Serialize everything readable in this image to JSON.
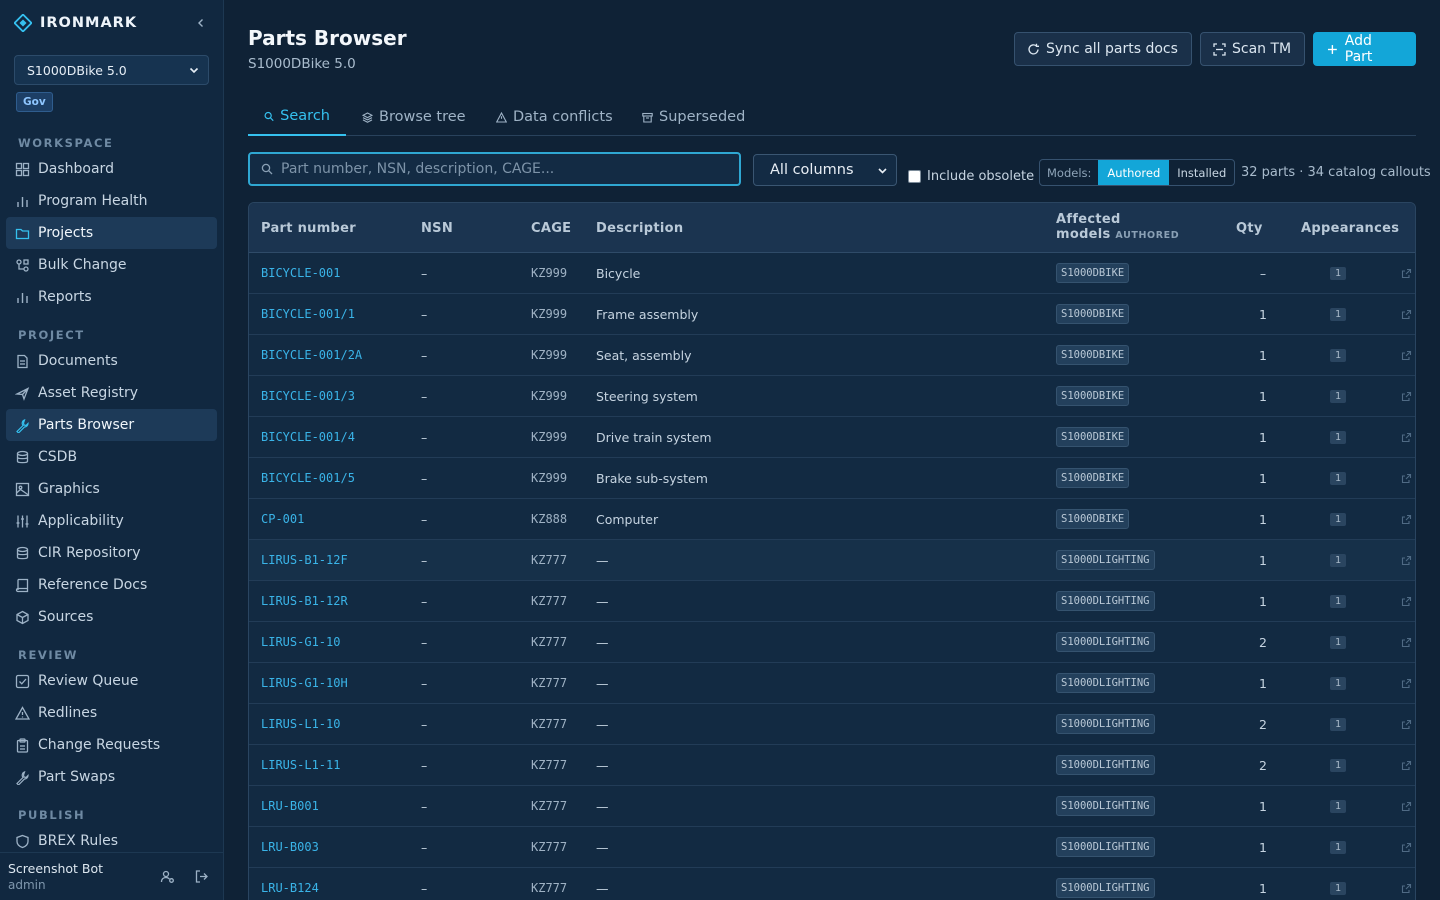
{
  "app": {
    "name": "IRONMARK"
  },
  "sidebar": {
    "project_select": "S1000DBike 5.0",
    "badge": "Gov",
    "sections": {
      "workspace": "WORKSPACE",
      "project": "PROJECT",
      "review": "REVIEW",
      "publish": "PUBLISH"
    },
    "items": [
      {
        "label": "Dashboard",
        "icon": "dashboard-icon"
      },
      {
        "label": "Program Health",
        "icon": "bar-chart-icon"
      },
      {
        "label": "Projects",
        "icon": "folder-icon"
      },
      {
        "label": "Bulk Change",
        "icon": "bulk-change-icon"
      },
      {
        "label": "Reports",
        "icon": "bar-chart-icon"
      },
      {
        "label": "Documents",
        "icon": "document-icon"
      },
      {
        "label": "Asset Registry",
        "icon": "airplane-icon"
      },
      {
        "label": "Parts Browser",
        "icon": "wrench-icon"
      },
      {
        "label": "CSDB",
        "icon": "database-icon"
      },
      {
        "label": "Graphics",
        "icon": "image-icon"
      },
      {
        "label": "Applicability",
        "icon": "sliders-icon"
      },
      {
        "label": "CIR Repository",
        "icon": "database-icon"
      },
      {
        "label": "Reference Docs",
        "icon": "book-icon"
      },
      {
        "label": "Sources",
        "icon": "package-icon"
      },
      {
        "label": "Review Queue",
        "icon": "check-square-icon"
      },
      {
        "label": "Redlines",
        "icon": "warning-icon"
      },
      {
        "label": "Change Requests",
        "icon": "clipboard-icon"
      },
      {
        "label": "Part Swaps",
        "icon": "wrench-icon"
      },
      {
        "label": "BREX Rules",
        "icon": "shield-icon"
      }
    ],
    "user": {
      "name": "Screenshot Bot",
      "role": "admin"
    }
  },
  "header": {
    "title": "Parts Browser",
    "subtitle": "S1000DBike 5.0",
    "sync_label": "Sync all parts docs",
    "scan_label": "Scan TM",
    "add_label": "Add Part"
  },
  "tabs": [
    "Search",
    "Browse tree",
    "Data conflicts",
    "Superseded"
  ],
  "toolbar": {
    "search_placeholder": "Part number, NSN, description, CAGE...",
    "column_select": "All columns",
    "include_obsolete": "Include obsolete",
    "models_label": "Models:",
    "models_authored": "Authored",
    "models_installed": "Installed",
    "count_text": "32 parts · 34 catalog callouts"
  },
  "table": {
    "headers": {
      "part_number": "Part number",
      "nsn": "NSN",
      "cage": "CAGE",
      "description": "Description",
      "affected_models": "Affected",
      "affected_models_2": "models",
      "affected_models_tag": "AUTHORED",
      "qty": "Qty",
      "appearances": "Appearances"
    },
    "rows": [
      {
        "part": "BICYCLE-001",
        "nsn": "–",
        "cage": "KZ999",
        "desc": "Bicycle",
        "model": "S1000DBIKE",
        "qty": "–",
        "app": "1"
      },
      {
        "part": "BICYCLE-001/1",
        "nsn": "–",
        "cage": "KZ999",
        "desc": "Frame assembly",
        "model": "S1000DBIKE",
        "qty": "1",
        "app": "1"
      },
      {
        "part": "BICYCLE-001/2A",
        "nsn": "–",
        "cage": "KZ999",
        "desc": "Seat, assembly",
        "model": "S1000DBIKE",
        "qty": "1",
        "app": "1"
      },
      {
        "part": "BICYCLE-001/3",
        "nsn": "–",
        "cage": "KZ999",
        "desc": "Steering system",
        "model": "S1000DBIKE",
        "qty": "1",
        "app": "1"
      },
      {
        "part": "BICYCLE-001/4",
        "nsn": "–",
        "cage": "KZ999",
        "desc": "Drive train system",
        "model": "S1000DBIKE",
        "qty": "1",
        "app": "1"
      },
      {
        "part": "BICYCLE-001/5",
        "nsn": "–",
        "cage": "KZ999",
        "desc": "Brake sub-system",
        "model": "S1000DBIKE",
        "qty": "1",
        "app": "1"
      },
      {
        "part": "CP-001",
        "nsn": "–",
        "cage": "KZ888",
        "desc": "Computer",
        "model": "S1000DBIKE",
        "qty": "1",
        "app": "1"
      },
      {
        "part": "LIRUS-B1-12F",
        "nsn": "–",
        "cage": "KZ777",
        "desc": "—",
        "model": "S1000DLIGHTING",
        "qty": "1",
        "app": "1"
      },
      {
        "part": "LIRUS-B1-12R",
        "nsn": "–",
        "cage": "KZ777",
        "desc": "—",
        "model": "S1000DLIGHTING",
        "qty": "1",
        "app": "1"
      },
      {
        "part": "LIRUS-G1-10",
        "nsn": "–",
        "cage": "KZ777",
        "desc": "—",
        "model": "S1000DLIGHTING",
        "qty": "2",
        "app": "1"
      },
      {
        "part": "LIRUS-G1-10H",
        "nsn": "–",
        "cage": "KZ777",
        "desc": "—",
        "model": "S1000DLIGHTING",
        "qty": "1",
        "app": "1"
      },
      {
        "part": "LIRUS-L1-10",
        "nsn": "–",
        "cage": "KZ777",
        "desc": "—",
        "model": "S1000DLIGHTING",
        "qty": "2",
        "app": "1"
      },
      {
        "part": "LIRUS-L1-11",
        "nsn": "–",
        "cage": "KZ777",
        "desc": "—",
        "model": "S1000DLIGHTING",
        "qty": "2",
        "app": "1"
      },
      {
        "part": "LRU-B001",
        "nsn": "–",
        "cage": "KZ777",
        "desc": "—",
        "model": "S1000DLIGHTING",
        "qty": "1",
        "app": "1"
      },
      {
        "part": "LRU-B003",
        "nsn": "–",
        "cage": "KZ777",
        "desc": "—",
        "model": "S1000DLIGHTING",
        "qty": "1",
        "app": "1"
      },
      {
        "part": "LRU-B124",
        "nsn": "–",
        "cage": "KZ777",
        "desc": "—",
        "model": "S1000DLIGHTING",
        "qty": "1",
        "app": "1"
      }
    ]
  },
  "colors": {
    "accent": "#13a6d8",
    "link": "#3ab4e8",
    "background": "#0f2236",
    "sidebar": "#112840"
  }
}
